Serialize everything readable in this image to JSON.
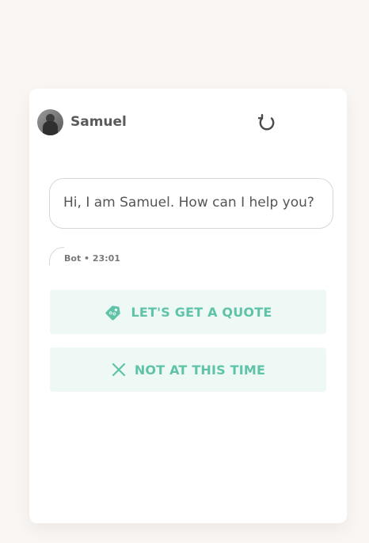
{
  "agent": {
    "name": "Samuel"
  },
  "message": {
    "text": "Hi, I am Samuel. How can I help you?",
    "meta": "Bot • 23:01"
  },
  "options": [
    {
      "label": "LET'S GET A QUOTE",
      "icon": "tag-icon"
    },
    {
      "label": "NOT AT THIS TIME",
      "icon": "close-icon"
    }
  ],
  "colors": {
    "accent": "#5ec3a7",
    "option_bg": "#eef8f5",
    "page_bg": "#faf6f3"
  }
}
